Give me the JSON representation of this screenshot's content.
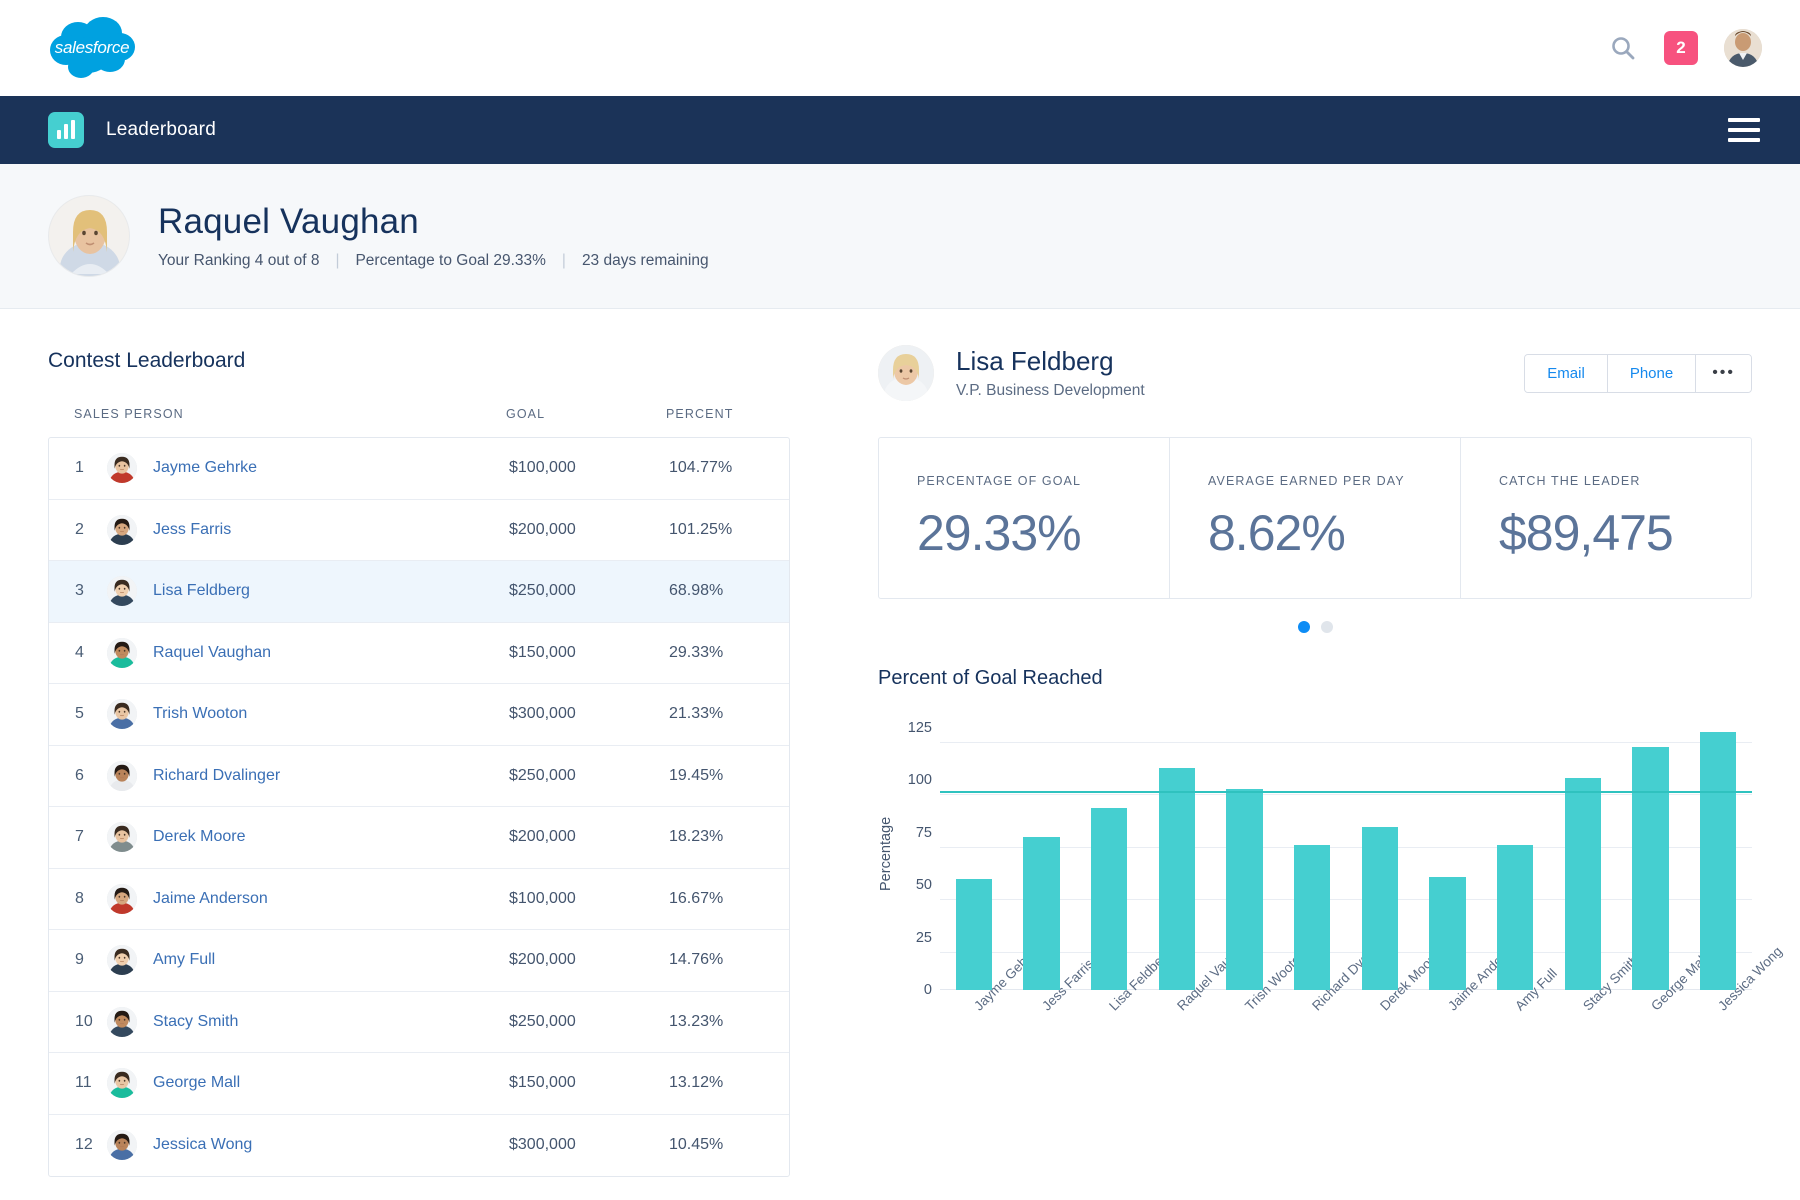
{
  "brand": {
    "logo_text": "salesforce",
    "logo_color": "#00a1e0",
    "navbar_color": "#1b3358",
    "accent_blue": "#1589ee",
    "teal": "#45cfd0",
    "badge_color": "#f7527f"
  },
  "topbar": {
    "search_icon": "search-icon",
    "notification_count": "2",
    "avatar": "user-avatar"
  },
  "appbar": {
    "icon": "bar-chart-icon",
    "title": "Leaderboard",
    "menu_icon": "hamburger-menu-icon"
  },
  "hero": {
    "name": "Raquel Vaughan",
    "ranking": "Your Ranking 4 out of 8",
    "percentage_to_goal": "Percentage to Goal 29.33%",
    "days_remaining": "23 days remaining",
    "separator": "|"
  },
  "leaderboard": {
    "title": "Contest Leaderboard",
    "columns": [
      "SALES PERSON",
      "GOAL",
      "PERCENT"
    ],
    "rows": [
      {
        "rank": "1",
        "name": "Jayme Gehrke",
        "goal": "$100,000",
        "percent": "104.77%",
        "active": false
      },
      {
        "rank": "2",
        "name": "Jess Farris",
        "goal": "$200,000",
        "percent": "101.25%",
        "active": false
      },
      {
        "rank": "3",
        "name": "Lisa Feldberg",
        "goal": "$250,000",
        "percent": "68.98%",
        "active": true
      },
      {
        "rank": "4",
        "name": "Raquel Vaughan",
        "goal": "$150,000",
        "percent": "29.33%",
        "active": false
      },
      {
        "rank": "5",
        "name": "Trish Wooton",
        "goal": "$300,000",
        "percent": "21.33%",
        "active": false
      },
      {
        "rank": "6",
        "name": "Richard Dvalinger",
        "goal": "$250,000",
        "percent": "19.45%",
        "active": false
      },
      {
        "rank": "7",
        "name": "Derek Moore",
        "goal": "$200,000",
        "percent": "18.23%",
        "active": false
      },
      {
        "rank": "8",
        "name": "Jaime Anderson",
        "goal": "$100,000",
        "percent": "16.67%",
        "active": false
      },
      {
        "rank": "9",
        "name": "Amy Full",
        "goal": "$200,000",
        "percent": "14.76%",
        "active": false
      },
      {
        "rank": "10",
        "name": "Stacy Smith",
        "goal": "$250,000",
        "percent": "13.23%",
        "active": false
      },
      {
        "rank": "11",
        "name": "George Mall",
        "goal": "$150,000",
        "percent": "13.12%",
        "active": false
      },
      {
        "rank": "12",
        "name": "Jessica Wong",
        "goal": "$300,000",
        "percent": "10.45%",
        "active": false
      }
    ]
  },
  "detail": {
    "name": "Lisa Feldberg",
    "role": "V.P. Business Development",
    "actions": [
      "Email",
      "Phone",
      "•••"
    ],
    "kpis": [
      {
        "label": "PERCENTAGE OF GOAL",
        "value": "29.33%"
      },
      {
        "label": "AVERAGE EARNED PER DAY",
        "value": "8.62%"
      },
      {
        "label": "CATCH THE LEADER",
        "value": "$89,475"
      }
    ],
    "carousel": {
      "total": 2,
      "active_index": 0
    }
  },
  "chart_data": {
    "type": "bar",
    "title": "Percent of Goal Reached",
    "xlabel": "",
    "ylabel": "Percentage",
    "ylim": [
      0,
      125
    ],
    "yticks": [
      0,
      25,
      50,
      75,
      100,
      125
    ],
    "grid": true,
    "bar_color": "#45cfd0",
    "reference_line": {
      "value": 95,
      "color": "#2fc2bf"
    },
    "categories": [
      "Jayme Gehrke",
      "Jess Farris",
      "Lisa Feldberg",
      "Raquel Vaughan",
      "Trish Wooton",
      "Richard Dvalinger",
      "Derek Moore",
      "Jaime Anderson",
      "Amy Full",
      "Stacy Smith",
      "George Mall",
      "Jessica Wong"
    ],
    "values": [
      53,
      73,
      87,
      106,
      96,
      69,
      78,
      54,
      69,
      101,
      116,
      123
    ]
  }
}
